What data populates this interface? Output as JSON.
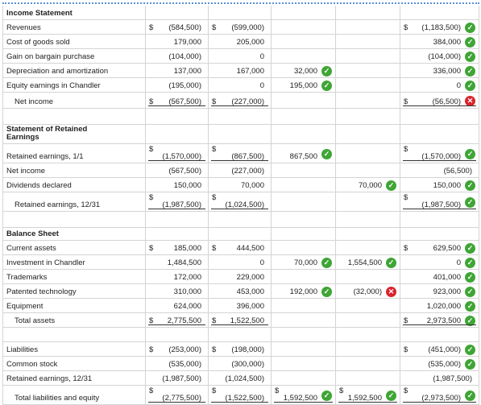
{
  "income": {
    "title": "Income Statement",
    "rows": [
      {
        "label": "Revenues",
        "p": "(584,500)",
        "p_dollar": "$",
        "c": "(599,000)",
        "c_dollar": "$",
        "d": "",
        "cr": "",
        "con": "(1,183,500)",
        "con_dollar": "$",
        "status": "ok"
      },
      {
        "label": "Cost of goods sold",
        "p": "179,000",
        "c": "205,000",
        "d": "",
        "cr": "",
        "con": "384,000",
        "status": "ok"
      },
      {
        "label": "Gain on bargain purchase",
        "p": "(104,000)",
        "c": "0",
        "d": "",
        "cr": "",
        "con": "(104,000)",
        "status": "ok"
      },
      {
        "label": "Depreciation and amortization",
        "p": "137,000",
        "c": "167,000",
        "d": "32,000",
        "cr": "",
        "con": "336,000",
        "status": "ok"
      },
      {
        "label": "Equity earnings in Chandler",
        "p": "(195,000)",
        "c": "0",
        "d": "195,000",
        "cr": "",
        "con": "0",
        "status": "ok"
      },
      {
        "label": "Net income",
        "p": "(567,500)",
        "p_dollar": "$",
        "c": "(227,000)",
        "c_dollar": "$",
        "d": "",
        "cr": "",
        "con": "(56,500)",
        "con_dollar": "$",
        "status": "err"
      }
    ]
  },
  "retained": {
    "title": "Statement of Retained Earnings",
    "rows": [
      {
        "label": "Retained earnings, 1/1",
        "p": "(1,570,000)",
        "p_dollar": "$",
        "c": "(867,500)",
        "c_dollar": "$",
        "d": "867,500",
        "cr": "",
        "con": "(1,570,000)",
        "con_dollar": "$",
        "status": "ok"
      },
      {
        "label": "Net income",
        "p": "(567,500)",
        "c": "(227,000)",
        "d": "",
        "cr": "",
        "con": "(56,500)"
      },
      {
        "label": "Dividends declared",
        "p": "150,000",
        "c": "70,000",
        "d": "",
        "cr": "70,000",
        "con": "150,000",
        "status": "ok"
      },
      {
        "label": "Retained earnings, 12/31",
        "p": "(1,987,500)",
        "p_dollar": "$",
        "c": "(1,024,500)",
        "c_dollar": "$",
        "d": "",
        "cr": "",
        "con": "(1,987,500)",
        "con_dollar": "$",
        "status": "ok"
      }
    ]
  },
  "balance": {
    "title": "Balance Sheet",
    "rows": [
      {
        "label": "Current assets",
        "p": "185,000",
        "p_dollar": "$",
        "c": "444,500",
        "c_dollar": "$",
        "d": "",
        "cr": "",
        "con": "629,500",
        "con_dollar": "$",
        "status": "ok"
      },
      {
        "label": "Investment in Chandler",
        "p": "1,484,500",
        "c": "0",
        "d": "70,000",
        "cr": "1,554,500",
        "con": "0",
        "status": "ok"
      },
      {
        "label": "Trademarks",
        "p": "172,000",
        "c": "229,000",
        "d": "",
        "cr": "",
        "con": "401,000",
        "status": "ok"
      },
      {
        "label": "Patented technology",
        "p": "310,000",
        "c": "453,000",
        "d": "192,000",
        "cr": "(32,000)",
        "con": "923,000",
        "status": "ok"
      },
      {
        "label": "Equipment",
        "p": "624,000",
        "c": "396,000",
        "d": "",
        "cr": "",
        "con": "1,020,000",
        "status": "ok"
      },
      {
        "label": "Total assets",
        "p": "2,775,500",
        "p_dollar": "$",
        "c": "1,522,500",
        "c_dollar": "$",
        "d": "",
        "cr": "",
        "con": "2,973,500",
        "con_dollar": "$",
        "status": "ok"
      }
    ]
  },
  "liab": {
    "rows": [
      {
        "label": "Liabilities",
        "p": "(253,000)",
        "p_dollar": "$",
        "c": "(198,000)",
        "c_dollar": "$",
        "d": "",
        "cr": "",
        "con": "(451,000)",
        "con_dollar": "$",
        "status": "ok"
      },
      {
        "label": "Common stock",
        "p": "(535,000)",
        "c": "(300,000)",
        "d": "",
        "cr": "",
        "con": "(535,000)",
        "status": "ok"
      },
      {
        "label": "Retained earnings, 12/31",
        "p": "(1,987,500)",
        "c": "(1,024,500)",
        "d": "",
        "cr": "",
        "con": "(1,987,500)"
      },
      {
        "label": "Total liabilities and equity",
        "p": "(2,775,500)",
        "p_dollar": "$",
        "c": "(1,522,500)",
        "c_dollar": "$",
        "d": "1,592,500",
        "d_dollar": "$",
        "cr": "1,592,500",
        "cr_dollar": "$",
        "con": "(2,973,500)",
        "con_dollar": "$",
        "status": "ok"
      }
    ]
  },
  "icons": {
    "ok": "check-circle-icon",
    "err": "x-circle-icon",
    "ok_color": "#3fa535",
    "err_color": "#d9252c"
  },
  "glyphs": {
    "ok": "✓",
    "err": "✕"
  }
}
